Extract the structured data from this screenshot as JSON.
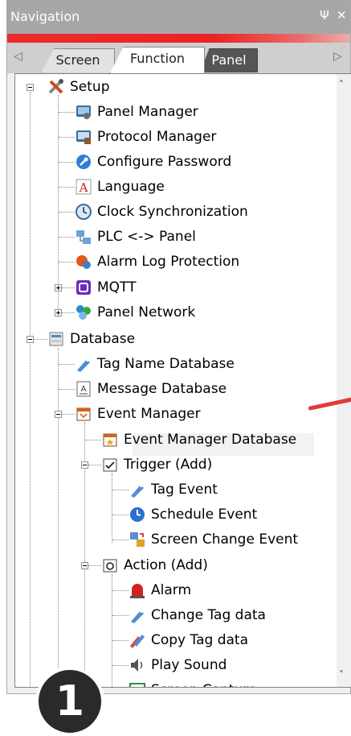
{
  "window": {
    "title": "Navigation",
    "pin_glyph": "Ψ",
    "close_glyph": "✕",
    "accent_color": "#ec2222"
  },
  "tabs": {
    "left_arrow": "◁",
    "right_arrow": "▷",
    "items": [
      {
        "label": "Screen",
        "state": "inactive"
      },
      {
        "label": "Function",
        "state": "active"
      },
      {
        "label": "Panel",
        "state": "inactive"
      }
    ]
  },
  "tree": {
    "setup": {
      "label": "Setup",
      "children": {
        "panel_manager": "Panel Manager",
        "protocol_manager": "Protocol Manager",
        "configure_password": "Configure Password",
        "language": "Language",
        "clock_sync": "Clock Synchronization",
        "plc_panel": "PLC <-> Panel",
        "alarm_log_protection": "Alarm Log Protection",
        "mqtt": "MQTT",
        "panel_network": "Panel Network"
      }
    },
    "database": {
      "label": "Database",
      "children": {
        "tag_name_db": "Tag Name Database",
        "message_db": "Message Database",
        "event_manager": "Event Manager",
        "event_manager_db": "Event Manager Database",
        "trigger": "Trigger (Add)",
        "tag_event": "Tag Event",
        "schedule_event": "Schedule Event",
        "screen_change_event": "Screen Change Event",
        "action": "Action (Add)",
        "alarm": "Alarm",
        "change_tag_data": "Change Tag data",
        "copy_tag_data": "Copy Tag data",
        "play_sound": "Play Sound",
        "screen_capture": "Screen Capture"
      }
    },
    "selected_item": "Event Manager Database"
  },
  "scrollbar": {
    "up": "˄",
    "down": "˅"
  },
  "callout": {
    "number": "1",
    "pointer_color": "#e23a3a"
  }
}
